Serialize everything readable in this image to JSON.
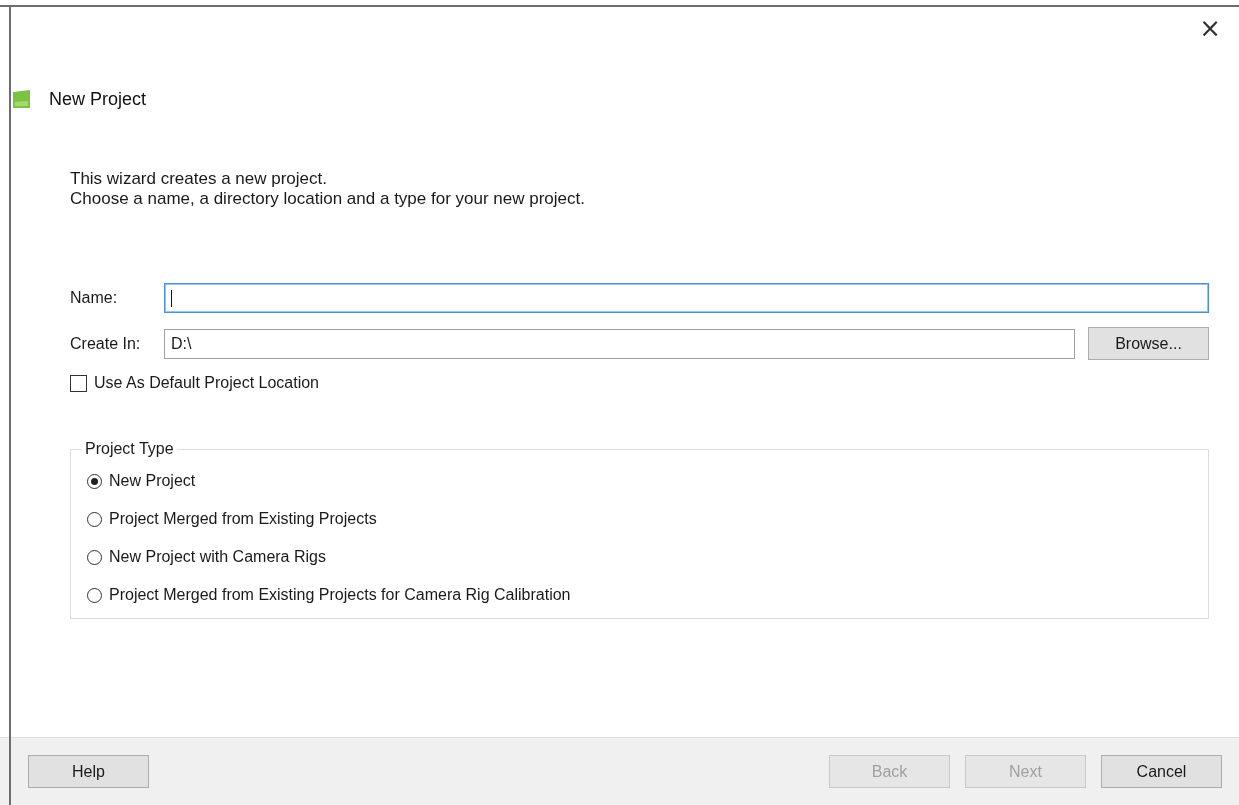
{
  "dialog": {
    "title": "New Project",
    "close": "×"
  },
  "intro": [
    "This wizard creates a new project.",
    "Choose a name, a directory location and a type for your new project."
  ],
  "fields": [
    {
      "label": "Name:",
      "focused": true
    },
    {
      "label": "Create In:",
      "value": "D:\\",
      "focused": false,
      "button": "Browse..."
    }
  ],
  "default_location": {
    "label": "Use As Default Project Location",
    "checked": false
  },
  "project_type": {
    "title": "Project Type",
    "options": [
      {
        "label": "New Project",
        "selected": true
      },
      {
        "label": "Project Merged from Existing Projects",
        "selected": false
      },
      {
        "label": "New Project with Camera Rigs",
        "selected": false
      },
      {
        "label": "Project Merged from Existing Projects for Camera Rig Calibration",
        "selected": false
      }
    ]
  },
  "footer": {
    "left": [
      {
        "label": "Help",
        "disabled": false
      }
    ],
    "right": [
      {
        "label": "Back",
        "disabled": true
      },
      {
        "label": "Next",
        "disabled": true
      },
      {
        "label": "Cancel",
        "disabled": false
      }
    ]
  }
}
